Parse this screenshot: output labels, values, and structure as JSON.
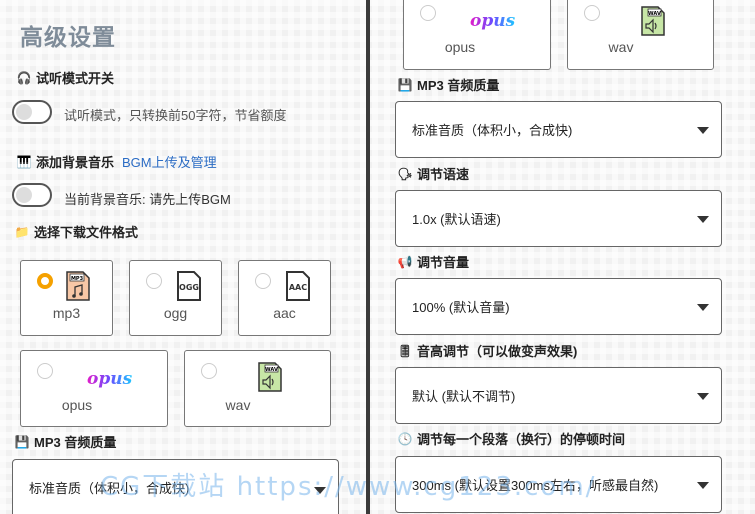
{
  "left": {
    "title": "高级设置",
    "trial": {
      "heading": "试听模式开关",
      "toggle_label": "试听模式，只转换前50字符，节省额度"
    },
    "bgm": {
      "heading": "添加背景音乐",
      "link": "BGM上传及管理",
      "toggle_label": "当前背景音乐: 请先上传BGM"
    },
    "format": {
      "heading": "选择下载文件格式",
      "cards": [
        {
          "label": "mp3",
          "badge": "MP3"
        },
        {
          "label": "ogg",
          "badge": "OGG"
        },
        {
          "label": "aac",
          "badge": "AAC"
        },
        {
          "label": "opus",
          "logo": "opus"
        },
        {
          "label": "wav",
          "badge": "WAV"
        }
      ]
    },
    "mp3_quality": {
      "heading": "MP3 音频质量",
      "value": "标准音质（体积小，合成快)"
    }
  },
  "right": {
    "top_cards": [
      {
        "label": "opus",
        "logo": "opus"
      },
      {
        "label": "wav",
        "badge": "WAV"
      }
    ],
    "mp3_quality": {
      "heading": "MP3 音频质量",
      "value": "标准音质（体积小，合成快)"
    },
    "speed": {
      "heading": "调节语速",
      "value": "1.0x (默认语速)"
    },
    "volume": {
      "heading": "调节音量",
      "value": "100% (默认音量)"
    },
    "pitch": {
      "heading": "音高调节（可以做变声效果)",
      "value": "默认 (默认不调节)"
    },
    "pause": {
      "heading": "调节每一个段落（换行）的停顿时间",
      "value": "300ms (默认设置300ms左右，听感最自然)"
    }
  },
  "watermark": "CG下载站 https://www.cg123.com/",
  "colors": {
    "accent": "#f5a100",
    "link": "#2b6cc4",
    "title": "#7f8c99"
  }
}
